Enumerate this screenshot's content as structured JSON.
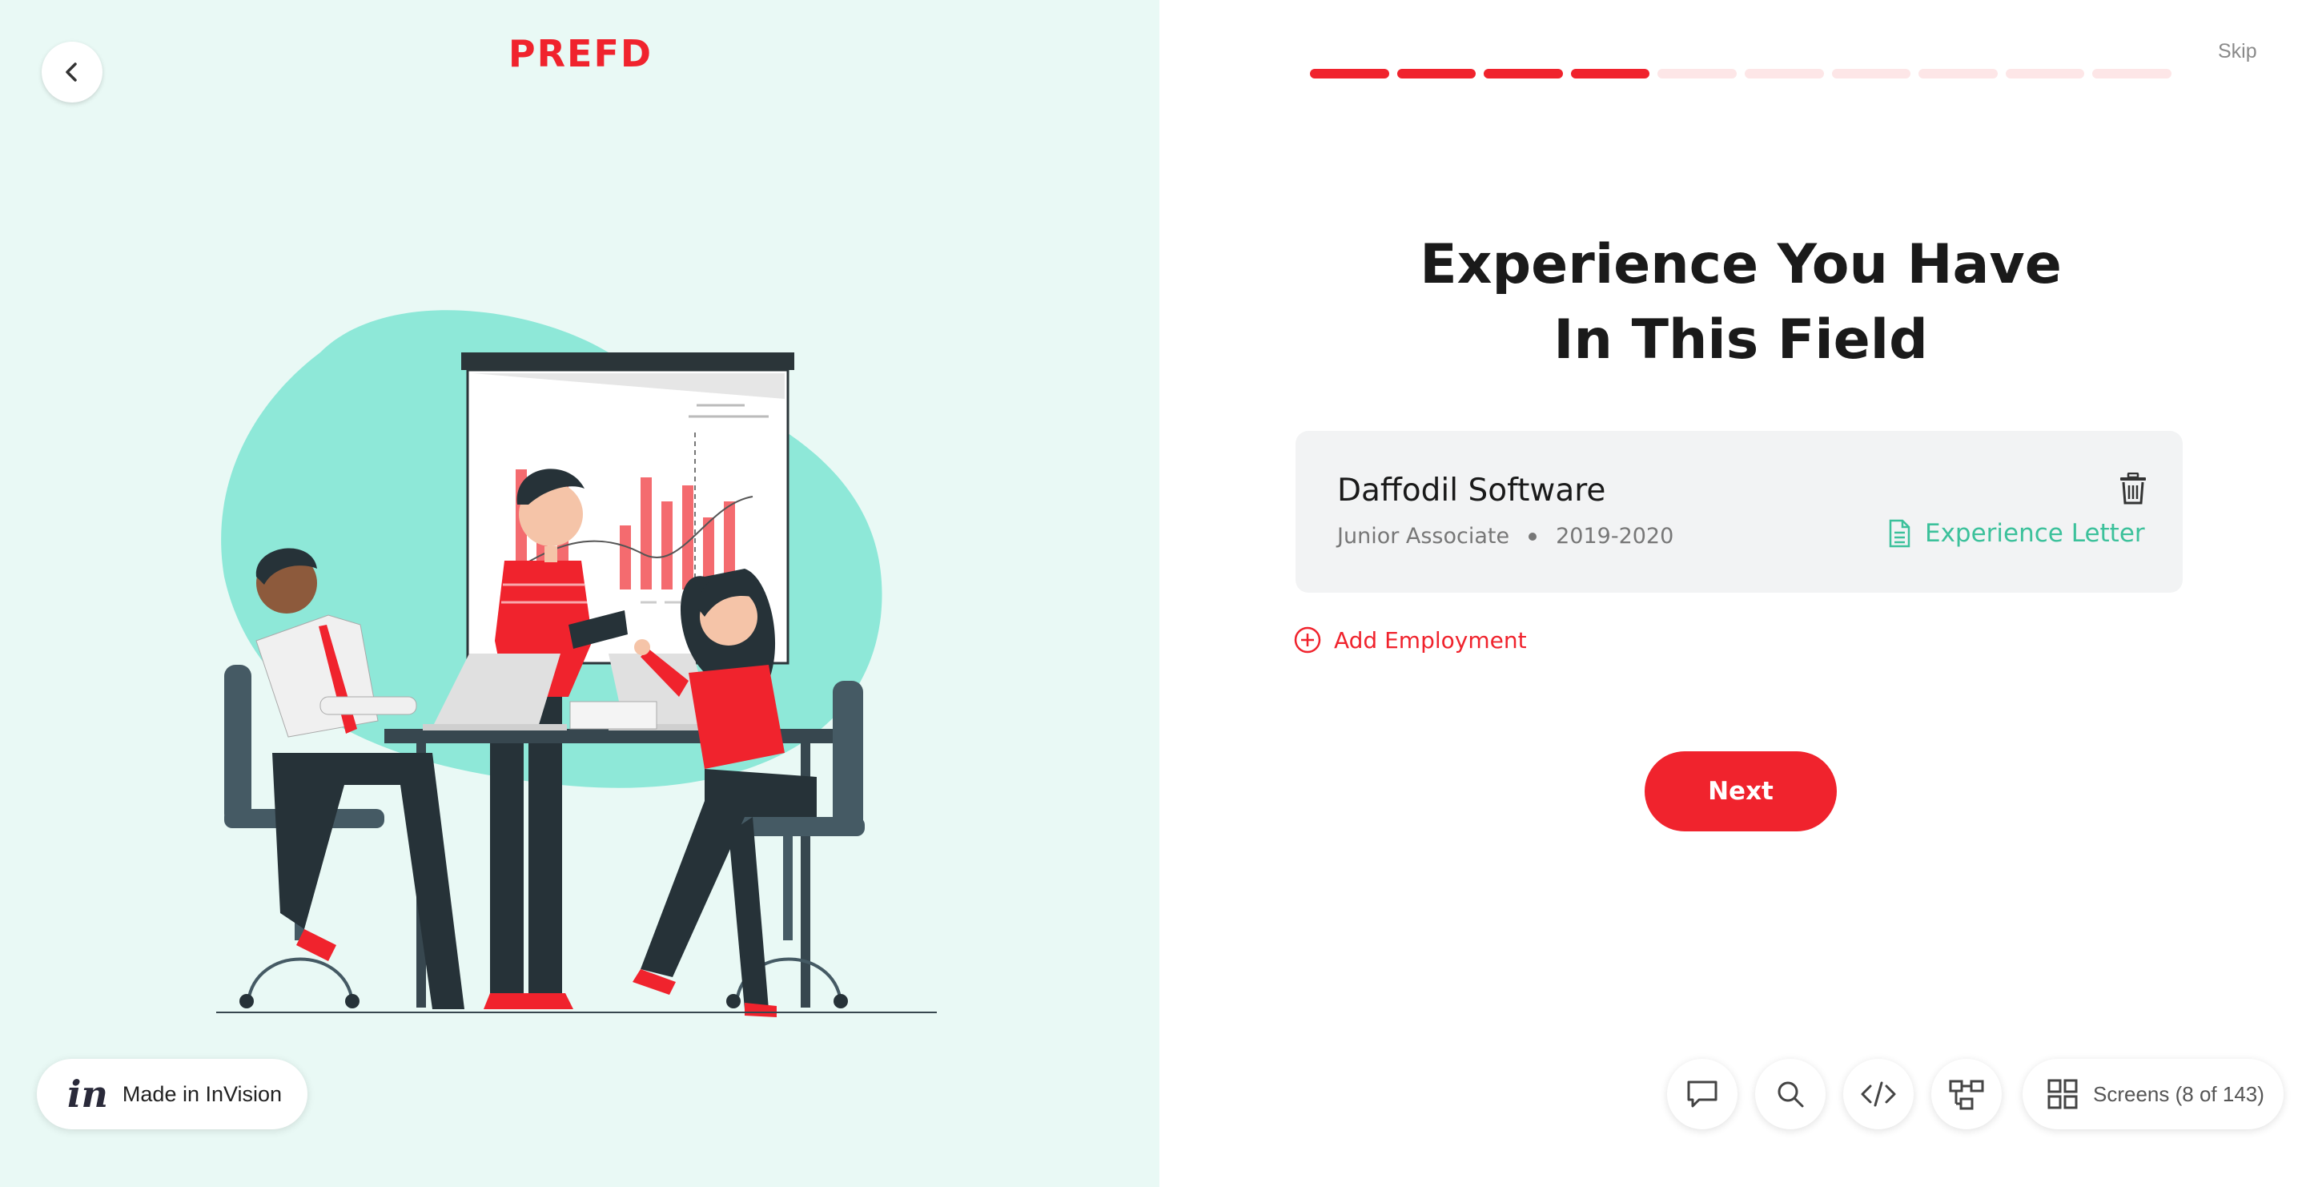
{
  "brand": {
    "logo_text": "PREFD",
    "accent": "#f0232d",
    "mint": "#8ee8d8",
    "green": "#3cc19b"
  },
  "nav": {
    "back_icon": "chevron-left-icon",
    "skip_label": "Skip"
  },
  "progress": {
    "total_steps": 10,
    "completed_steps": 4
  },
  "page": {
    "title_line1": "Experience You Have",
    "title_line2": "In This Field"
  },
  "employment": [
    {
      "company": "Daffodil Software",
      "role": "Junior Associate",
      "period": "2019-2020",
      "letter_label": "Experience Letter"
    }
  ],
  "actions": {
    "add_employment_label": "Add Employment",
    "next_label": "Next"
  },
  "footer": {
    "invision_label": "Made in InVision",
    "screens_label": "Screens (8 of 143)",
    "tools": [
      "comment-icon",
      "search-icon",
      "code-icon",
      "flow-icon"
    ]
  }
}
